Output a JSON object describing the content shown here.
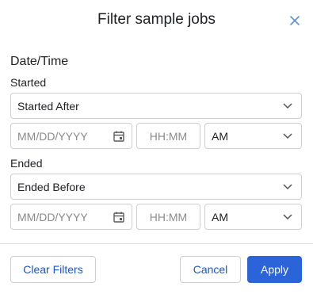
{
  "dialog": {
    "title": "Filter sample jobs"
  },
  "section": {
    "label": "Date/Time"
  },
  "started": {
    "label": "Started",
    "mode_value": "Started After",
    "date_placeholder": "MM/DD/YYYY",
    "time_placeholder": "HH:MM",
    "ampm_value": "AM"
  },
  "ended": {
    "label": "Ended",
    "mode_value": "Ended Before",
    "date_placeholder": "MM/DD/YYYY",
    "time_placeholder": "HH:MM",
    "ampm_value": "AM"
  },
  "footer": {
    "clear_label": "Clear Filters",
    "cancel_label": "Cancel",
    "apply_label": "Apply"
  },
  "colors": {
    "accent": "#2b63d9",
    "close_icon": "#5f8fd8"
  }
}
